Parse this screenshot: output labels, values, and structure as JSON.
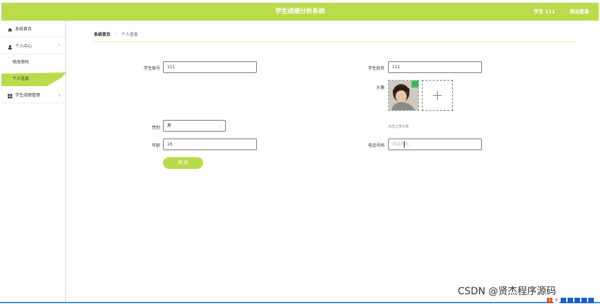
{
  "header": {
    "title": "学生成绩分析系统",
    "user": "学生 111",
    "logout": "退出登录"
  },
  "sidebar": {
    "items": [
      {
        "label": "系统首页",
        "icon": "home-icon"
      },
      {
        "label": "个人中心",
        "icon": "user-icon",
        "expanded": true,
        "children": [
          "修改密码",
          "个人信息"
        ]
      },
      {
        "label": "学生成绩管理",
        "icon": "grid-icon",
        "expanded": false
      }
    ],
    "active": "个人信息",
    "chevron_up": "^",
    "chevron_down": "v"
  },
  "breadcrumb": {
    "home": "系统首页",
    "separator": "⋮",
    "current": "个人信息"
  },
  "form": {
    "student_no_label": "学生账号",
    "student_no_value": "111",
    "student_name_label": "学生姓名",
    "student_name_value": "111",
    "avatar_label": "头像",
    "upload_plus": "+",
    "upload_hint": "点击上传头像",
    "gender_label": "性别",
    "gender_value": "男",
    "gender_arrow": "⌵",
    "age_label": "年龄",
    "age_value": "16",
    "phone_label": "电话号码",
    "phone_placeholder": "电话号码",
    "submit_label": "修 改"
  },
  "watermark": "CSDN @贤杰程序源码",
  "tray": {
    "icons": [
      "ime-icon",
      "lang-icon",
      "punct-icon",
      "mic-icon",
      "keyboard-icon",
      "shirt-icon",
      "apps-icon"
    ],
    "ime_glyph": "S",
    "lang_text": "中"
  },
  "colors": {
    "accent": "#b8dc4b",
    "taskbar_line": "#3a8ee6"
  }
}
